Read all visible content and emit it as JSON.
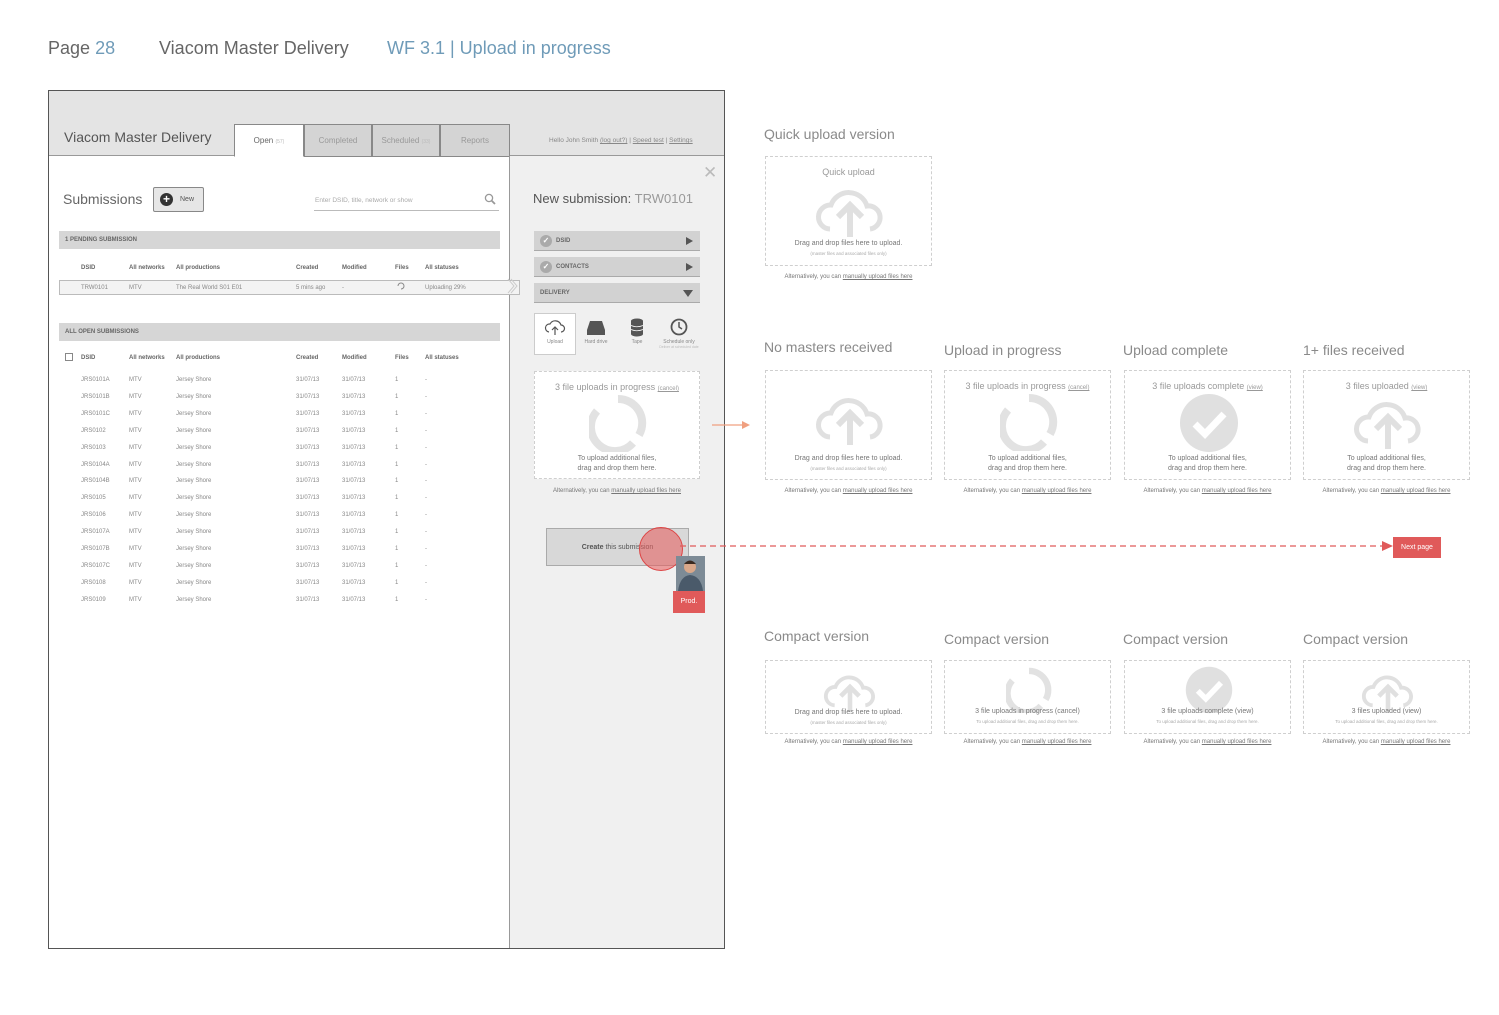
{
  "header": {
    "page_label": "Page",
    "page_number": "28",
    "doc_title": "Viacom Master Delivery",
    "wf_label": "WF 3.1 |  Upload in progress"
  },
  "app": {
    "name": "Viacom Master Delivery",
    "tabs": [
      {
        "label": "Open",
        "count": "(57)"
      },
      {
        "label": "Completed",
        "count": ""
      },
      {
        "label": "Scheduled",
        "count": "(33)"
      },
      {
        "label": "Reports",
        "count": ""
      }
    ],
    "greeting": "Hello John Smith",
    "logout": "(log out?)",
    "speed_test": "Speed test",
    "settings": "Settings",
    "sep": "|"
  },
  "submissions": {
    "title": "Submissions",
    "new_label": "New",
    "search_placeholder": "Enter DSID, title, network or show",
    "pending_header": "1 PENDING SUBMISSION",
    "open_header": "ALL OPEN SUBMISSIONS",
    "columns": [
      "DSID",
      "All networks",
      "All productions",
      "Created",
      "Modified",
      "Files",
      "All statuses"
    ],
    "pending_row": [
      "TRW0101",
      "MTV",
      "The Real World S01 E01",
      "5 mins ago",
      "-",
      "",
      "Uploading 29%"
    ],
    "rows": [
      [
        "JRS0101A",
        "MTV",
        "Jersey Shore",
        "31/07/13",
        "31/07/13",
        "1",
        "-"
      ],
      [
        "JRS0101B",
        "MTV",
        "Jersey Shore",
        "31/07/13",
        "31/07/13",
        "1",
        "-"
      ],
      [
        "JRS0101C",
        "MTV",
        "Jersey Shore",
        "31/07/13",
        "31/07/13",
        "1",
        "-"
      ],
      [
        "JRS0102",
        "MTV",
        "Jersey Shore",
        "31/07/13",
        "31/07/13",
        "1",
        "-"
      ],
      [
        "JRS0103",
        "MTV",
        "Jersey Shore",
        "31/07/13",
        "31/07/13",
        "1",
        "-"
      ],
      [
        "JRS0104A",
        "MTV",
        "Jersey Shore",
        "31/07/13",
        "31/07/13",
        "1",
        "-"
      ],
      [
        "JRS0104B",
        "MTV",
        "Jersey Shore",
        "31/07/13",
        "31/07/13",
        "1",
        "-"
      ],
      [
        "JRS0105",
        "MTV",
        "Jersey Shore",
        "31/07/13",
        "31/07/13",
        "1",
        "-"
      ],
      [
        "JRS0106",
        "MTV",
        "Jersey Shore",
        "31/07/13",
        "31/07/13",
        "1",
        "-"
      ],
      [
        "JRS0107A",
        "MTV",
        "Jersey Shore",
        "31/07/13",
        "31/07/13",
        "1",
        "-"
      ],
      [
        "JRS0107B",
        "MTV",
        "Jersey Shore",
        "31/07/13",
        "31/07/13",
        "1",
        "-"
      ],
      [
        "JRS0107C",
        "MTV",
        "Jersey Shore",
        "31/07/13",
        "31/07/13",
        "1",
        "-"
      ],
      [
        "JRS0108",
        "MTV",
        "Jersey Shore",
        "31/07/13",
        "31/07/13",
        "1",
        "-"
      ],
      [
        "JRS0109",
        "MTV",
        "Jersey Shore",
        "31/07/13",
        "31/07/13",
        "1",
        "-"
      ]
    ]
  },
  "new_submission": {
    "title": "New submission:",
    "id": "TRW0101",
    "sections": [
      "DSID",
      "CONTACTS",
      "DELIVERY"
    ],
    "methods": [
      "Upload",
      "Hard drive",
      "Tape",
      "Schedule only"
    ],
    "schedule_sub": "Deliver at scheduled date",
    "upload_head": "3 file uploads in progress",
    "upload_cancel": "(cancel)",
    "upload_body1": "To upload additional files,",
    "upload_body2": "drag and drop them here.",
    "create_bold": "Create",
    "create_rest": " this submission",
    "prod_label": "Prod."
  },
  "alt": {
    "prefix": "Alternatively, you can ",
    "link": "manually upload files here"
  },
  "variants": {
    "quick_title": "Quick upload version",
    "quick_head": "Quick upload",
    "drag": "Drag and drop files here to upload.",
    "drag_note": "(master files and associated files only)",
    "no_masters": "No masters received",
    "in_progress": "Upload in progress",
    "complete": "Upload complete",
    "received": "1+ files received",
    "progress_head": "3 file uploads in progress",
    "progress_link": "(cancel)",
    "complete_head": "3 file uploads complete",
    "complete_link": "(view)",
    "received_head": "3 files uploaded",
    "received_link": "(view)",
    "add1": "To upload additional files,",
    "add2": "drag and drop them here.",
    "compact": "Compact version",
    "compact_add": "To upload additional files, drag and drop them here.",
    "compact_progress": "3 file uploads in progress (cancel)",
    "compact_complete": "3 file uploads complete (view)",
    "compact_received": "3 files uploaded (view)"
  },
  "next_page": "Next page",
  "colors": {
    "accent": "#6f9bb8",
    "hotspot": "#e05a5a"
  }
}
